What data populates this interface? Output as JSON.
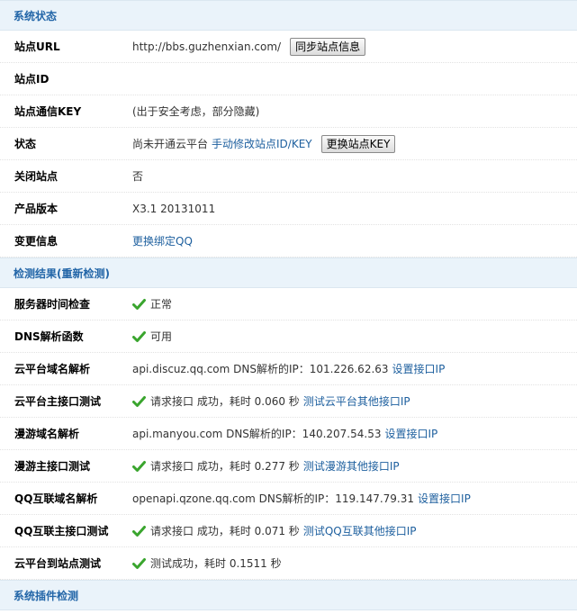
{
  "system_status": {
    "header": "系统状态",
    "rows": [
      {
        "label": "站点URL",
        "value": "http://bbs.guzhenxian.com/",
        "button": "同步站点信息"
      },
      {
        "label": "站点ID",
        "value": ""
      },
      {
        "label": "站点通信KEY",
        "value": "(出于安全考虑，部分隐藏)"
      },
      {
        "label": "状态",
        "value": "尚未开通云平台",
        "link": "手动修改站点ID/KEY",
        "button": "更换站点KEY"
      },
      {
        "label": "关闭站点",
        "value": "否"
      },
      {
        "label": "产品版本",
        "value": "X3.1 20131011"
      },
      {
        "label": "变更信息",
        "link": "更换绑定QQ"
      }
    ]
  },
  "check_results": {
    "header": "检测结果",
    "header_link": "(重新检测)",
    "rows": [
      {
        "label": "服务器时间检查",
        "status_icon": "check-icon",
        "value": "正常"
      },
      {
        "label": "DNS解析函数",
        "status_icon": "check-icon",
        "value": "可用"
      },
      {
        "label": "云平台域名解析",
        "value": "api.discuz.qq.com DNS解析的IP：101.226.62.63",
        "link": "设置接口IP"
      },
      {
        "label": "云平台主接口测试",
        "status_icon": "check-icon",
        "value": "请求接口 成功，耗时 0.060 秒",
        "link": "测试云平台其他接口IP"
      },
      {
        "label": "漫游域名解析",
        "value": "api.manyou.com DNS解析的IP：140.207.54.53",
        "link": "设置接口IP"
      },
      {
        "label": "漫游主接口测试",
        "status_icon": "check-icon",
        "value": "请求接口 成功，耗时 0.277 秒",
        "link": "测试漫游其他接口IP"
      },
      {
        "label": "QQ互联域名解析",
        "value": "openapi.qzone.qq.com DNS解析的IP：119.147.79.31",
        "link": "设置接口IP"
      },
      {
        "label": "QQ互联主接口测试",
        "status_icon": "check-icon",
        "value": "请求接口 成功，耗时 0.071 秒",
        "link": "测试QQ互联其他接口IP"
      },
      {
        "label": "云平台到站点测试",
        "status_icon": "check-icon",
        "value": "测试成功，耗时 0.1511 秒"
      }
    ]
  },
  "plugin_check": {
    "header": "系统插件检测"
  },
  "colors": {
    "header_bg": "#eaf3fa",
    "header_text": "#2366a8",
    "link": "#1d5f9e",
    "check": "#3aa52e"
  }
}
